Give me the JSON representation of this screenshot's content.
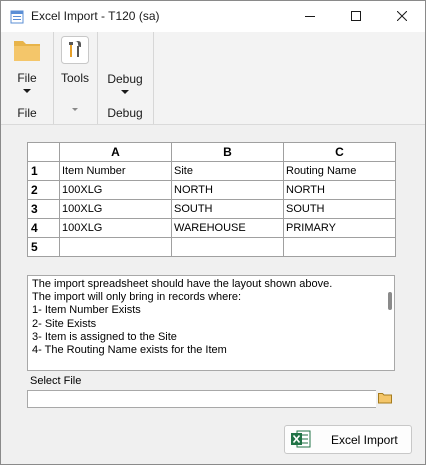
{
  "window": {
    "title": "Excel Import  -  T120 (sa)"
  },
  "icons": {
    "app": "app-icon",
    "minimize": "minimize-icon",
    "maximize": "maximize-icon",
    "close": "close-icon",
    "file": "folder-icon",
    "tools": "tools-icon",
    "browse": "folder-icon",
    "excel": "excel-icon"
  },
  "ribbon": {
    "file_button": "File",
    "file_group": "File",
    "tools_button": "Tools",
    "debug_button": "Debug",
    "debug_group": "Debug"
  },
  "grid": {
    "columns": [
      "A",
      "B",
      "C"
    ],
    "rows": [
      {
        "num": "1",
        "cells": [
          "Item Number",
          "Site",
          "Routing Name"
        ]
      },
      {
        "num": "2",
        "cells": [
          "100XLG",
          "NORTH",
          "NORTH"
        ]
      },
      {
        "num": "3",
        "cells": [
          "100XLG",
          "SOUTH",
          "SOUTH"
        ]
      },
      {
        "num": "4",
        "cells": [
          "100XLG",
          "WAREHOUSE",
          "PRIMARY"
        ]
      },
      {
        "num": "5",
        "cells": [
          "",
          "",
          ""
        ]
      }
    ]
  },
  "instructions": "The import spreadsheet should have the layout shown above.\nThe import will only bring in records where:\n1- Item Number Exists\n2- Site Exists\n3- Item is assigned to the Site\n4- The Routing Name exists for the Item",
  "select_file": {
    "label": "Select File",
    "value": ""
  },
  "excel_import_button": "Excel Import",
  "colors": {
    "ribbon_bg": "#f3f3f3",
    "window_bg": "#f0f0f0",
    "grid_border": "#a0a0a0"
  }
}
